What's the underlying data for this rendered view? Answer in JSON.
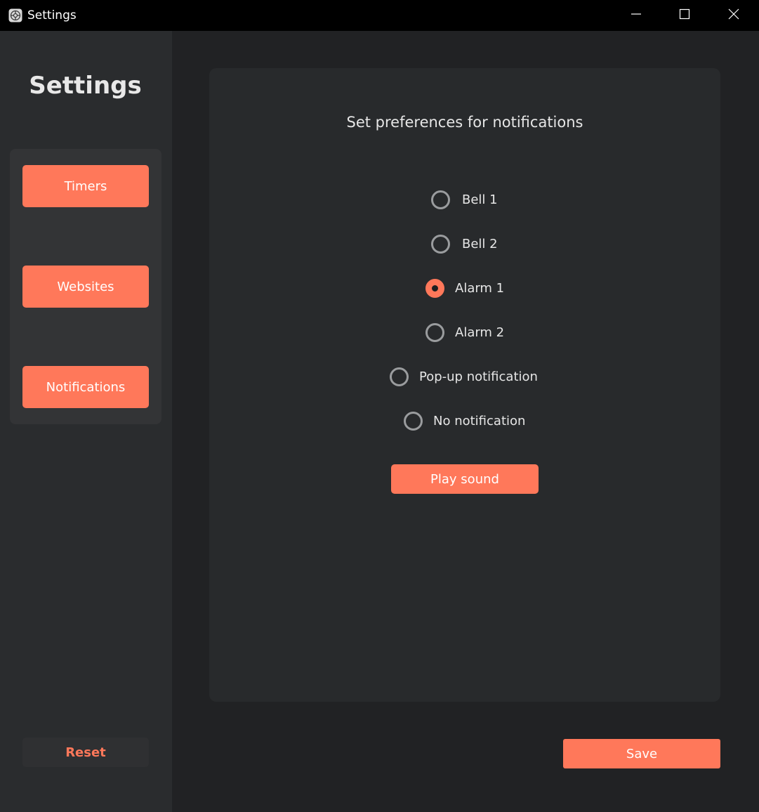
{
  "window": {
    "title": "Settings",
    "icon": "settings-gear-icon",
    "controls": [
      "minimize-icon",
      "maximize-icon",
      "close-icon"
    ]
  },
  "sidebar": {
    "title": "Settings",
    "nav": [
      {
        "label": "Timers"
      },
      {
        "label": "Websites"
      },
      {
        "label": "Notifications"
      }
    ],
    "reset_label": "Reset"
  },
  "main": {
    "heading": "Set preferences for notifications",
    "options": [
      {
        "label": "Bell 1",
        "selected": false
      },
      {
        "label": "Bell 2",
        "selected": false
      },
      {
        "label": "Alarm 1",
        "selected": true
      },
      {
        "label": "Alarm 2",
        "selected": false
      },
      {
        "label": "Pop-up notification",
        "selected": false
      },
      {
        "label": "No notification",
        "selected": false
      }
    ],
    "play_label": "Play sound"
  },
  "footer": {
    "save_label": "Save"
  },
  "colors": {
    "accent": "#ff785a",
    "background": "#212224",
    "sidebar": "#2a2c2e",
    "card": "#282a2c",
    "titlebar": "#000000"
  }
}
